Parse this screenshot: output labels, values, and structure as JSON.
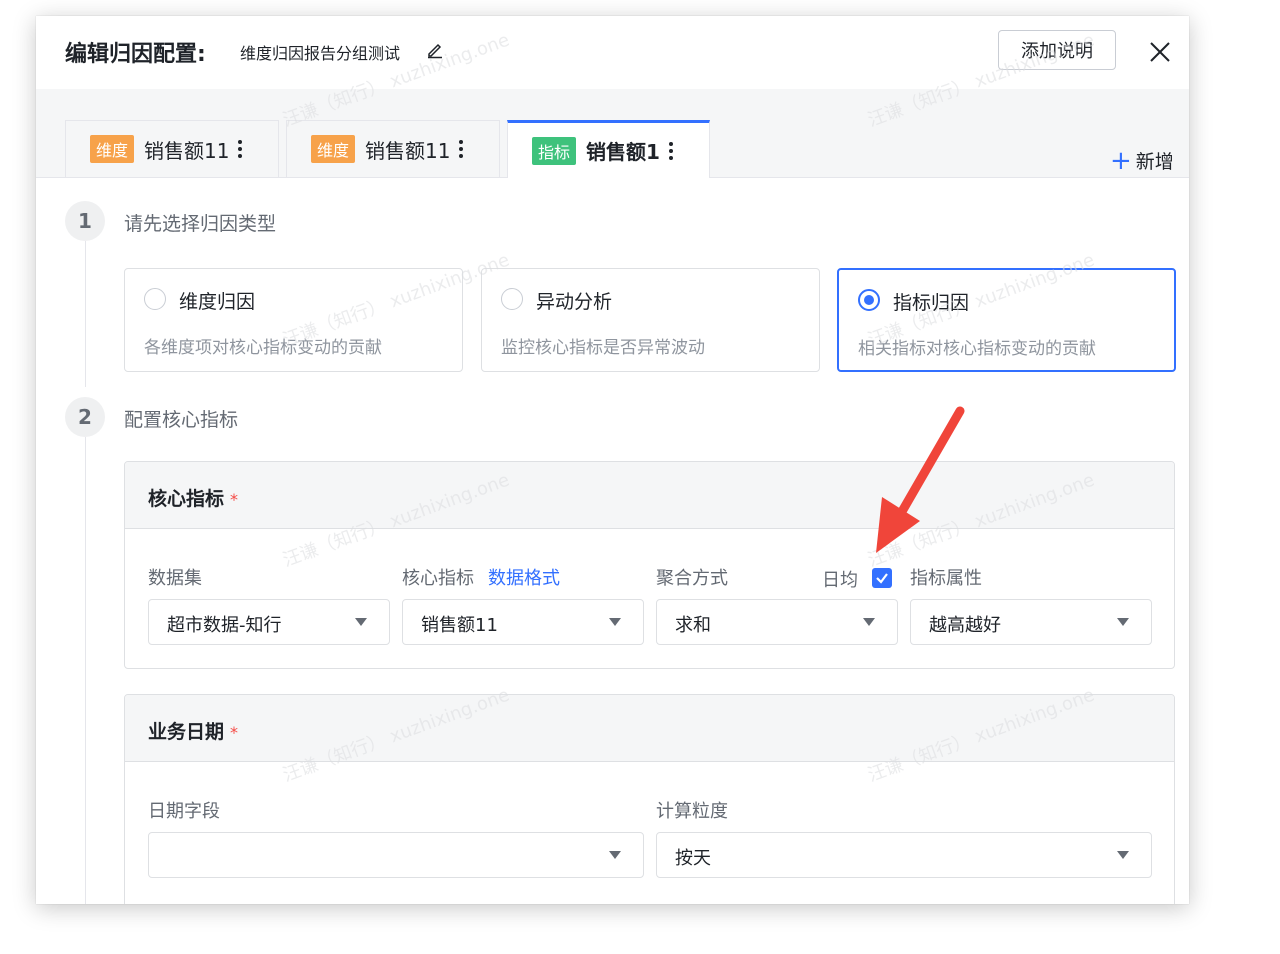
{
  "header": {
    "title": "编辑归因配置:",
    "subtitle": "维度归因报告分组测试",
    "add_note_label": "添加说明"
  },
  "tabs": [
    {
      "tag": "维度",
      "label": "销售额11",
      "tag_color": "#f7a24a"
    },
    {
      "tag": "维度",
      "label": "销售额11",
      "tag_color": "#f7a24a"
    },
    {
      "tag": "指标",
      "label": "销售额1",
      "tag_color": "#3ec27c",
      "active": true
    }
  ],
  "add_tab_label": "新增",
  "steps": [
    {
      "num": "1",
      "title": "请先选择归因类型"
    },
    {
      "num": "2",
      "title": "配置核心指标"
    }
  ],
  "attribution_types": [
    {
      "title": "维度归因",
      "desc": "各维度项对核心指标变动的贡献",
      "selected": false
    },
    {
      "title": "异动分析",
      "desc": "监控核心指标是否异常波动",
      "selected": false
    },
    {
      "title": "指标归因",
      "desc": "相关指标对核心指标变动的贡献",
      "selected": true
    }
  ],
  "core_metric": {
    "section_title": "核心指标",
    "required_mark": "*",
    "dataset_label": "数据集",
    "dataset_value": "超市数据-知行",
    "metric_label": "核心指标",
    "data_format_link": "数据格式",
    "metric_value": "销售额11",
    "aggregation_label": "聚合方式",
    "aggregation_value": "求和",
    "daily_avg_label": "日均",
    "daily_avg_checked": true,
    "attribute_label": "指标属性",
    "attribute_value": "越高越好"
  },
  "business_date": {
    "section_title": "业务日期",
    "required_mark": "*",
    "date_field_label": "日期字段",
    "date_field_value": "",
    "granularity_label": "计算粒度",
    "granularity_value": "按天"
  },
  "watermark": {
    "text": "汪谦（知行） xuzhixing.one"
  },
  "colors": {
    "accent": "#3370ff",
    "dimension_tag": "#f7a24a",
    "metric_tag": "#3ec27c",
    "required": "#f54a45",
    "annotation_arrow": "#f0453a"
  }
}
